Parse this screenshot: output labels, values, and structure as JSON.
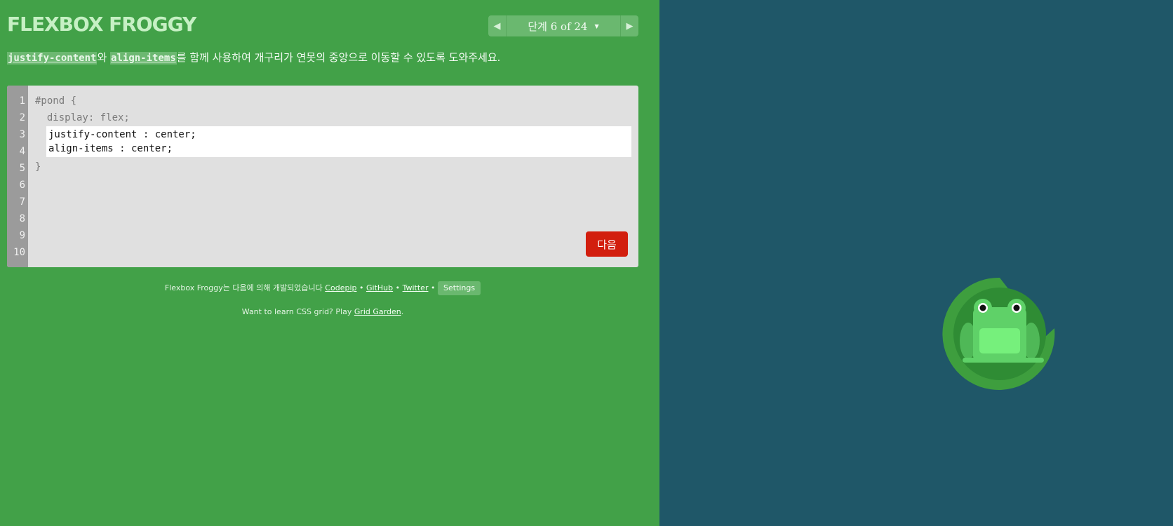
{
  "header": {
    "title": "FLEXBOX FROGGY",
    "level_label": "단계 6 of 24",
    "prev_icon": "triangle-left-icon",
    "next_icon": "triangle-right-icon",
    "dropdown_icon": "caret-down-icon"
  },
  "instructions": {
    "keyword_1": "justify-content",
    "connector": "와",
    "keyword_2": "align-items",
    "text": "를 함께 사용하여 개구리가 연못의 중앙으로 이동할 수 있도록 도와주세요."
  },
  "editor": {
    "line_numbers": [
      "1",
      "2",
      "3",
      "4",
      "5",
      "6",
      "7",
      "8",
      "9",
      "10"
    ],
    "line_1": "#pond {",
    "line_2": "  display: flex;",
    "line_5": "}",
    "input_value": "justify-content : center;\nalign-items : center;",
    "next_button_label": "다음"
  },
  "footer": {
    "credit_text": "Flexbox Froggy는 다음에 의해 개발되었습니다",
    "codepip_link": "Codepip",
    "github_link": "GitHub",
    "twitter_link": "Twitter",
    "separator": "•",
    "settings_label": "Settings",
    "promo_text": "Want to learn CSS grid? Play",
    "promo_link": "Grid Garden",
    "promo_end": "."
  },
  "colors": {
    "sidebar_bg": "#42a148",
    "pond_bg": "#1f5768",
    "next_button": "#d21e0e",
    "lilypad": "#3e9e3e",
    "frog": "#5fd168"
  },
  "pond": {
    "frog_icon": "green-frog-icon",
    "lilypad_icon": "lilypad-icon"
  }
}
